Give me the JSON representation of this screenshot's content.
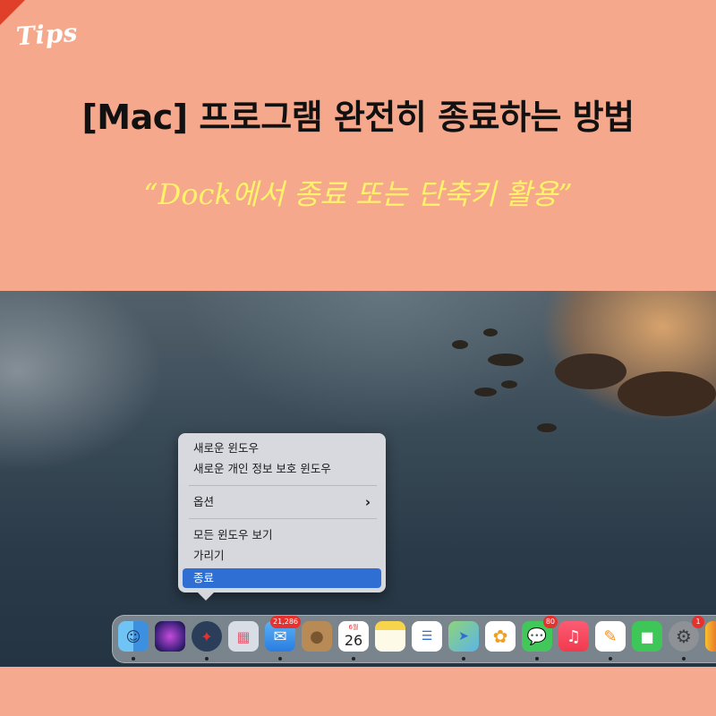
{
  "banner": {
    "badge_text": "Tips",
    "title": "[Mac] 프로그램 완전히 종료하는 방법",
    "subtitle": "“Dock에서 종료 또는 단축키 활용”"
  },
  "context_menu": {
    "new_window": "새로운 윈도우",
    "new_private_window": "새로운 개인 정보 보호 윈도우",
    "options": "옵션",
    "options_chevron": "›",
    "show_all_windows": "모든 윈도우 보기",
    "hide": "가리기",
    "quit": "종료"
  },
  "dock": {
    "mail_badge": "21,286",
    "calendar_month": "6월",
    "calendar_day": "26",
    "messages_badge": "80",
    "settings_badge": "1",
    "apps": [
      "finder-icon",
      "siri-icon",
      "safari-icon",
      "launchpad-icon",
      "mail-icon",
      "contacts-icon",
      "calendar-icon",
      "notes-icon",
      "reminders-icon",
      "maps-icon",
      "photos-icon",
      "messages-icon",
      "music-icon",
      "pages-icon",
      "facetime-icon",
      "system-settings-icon",
      "numbers-icon"
    ]
  },
  "colors": {
    "banner_bg": "#f6a88c",
    "title_text": "#111111",
    "subtitle_text": "#fff36a",
    "menu_highlight": "#2f6fd4"
  }
}
